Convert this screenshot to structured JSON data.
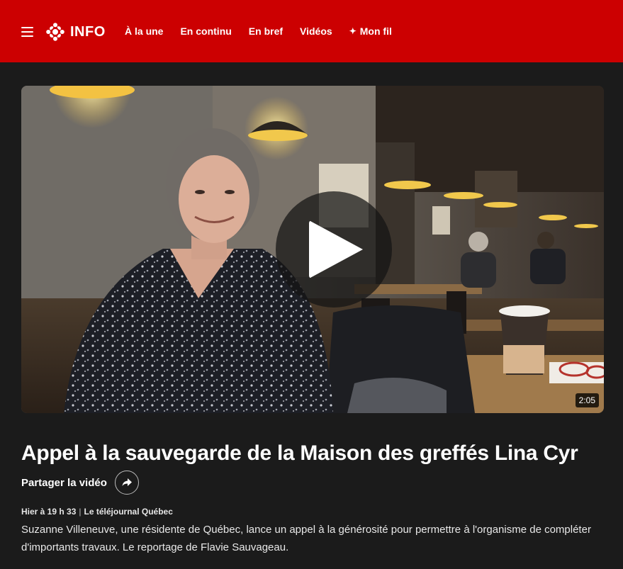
{
  "header": {
    "brand": "INFO",
    "nav": [
      {
        "label": "À la une"
      },
      {
        "label": "En continu"
      },
      {
        "label": "En bref"
      },
      {
        "label": "Vidéos"
      },
      {
        "label": "Mon fil",
        "icon": "sparkle-icon"
      }
    ],
    "colors": {
      "bar": "#cc0001"
    }
  },
  "video": {
    "duration": "2:05"
  },
  "article": {
    "title": "Appel à la sauvegarde de la Maison des greffés Lina Cyr",
    "share_label": "Partager la vidéo",
    "timestamp": "Hier à 19 h 33",
    "program": "Le téléjournal Québec",
    "description": "Suzanne Villeneuve, une résidente de Québec, lance un appel à la générosité pour permettre à l'organisme de compléter d'importants travaux. Le reportage de Flavie Sauvageau."
  }
}
